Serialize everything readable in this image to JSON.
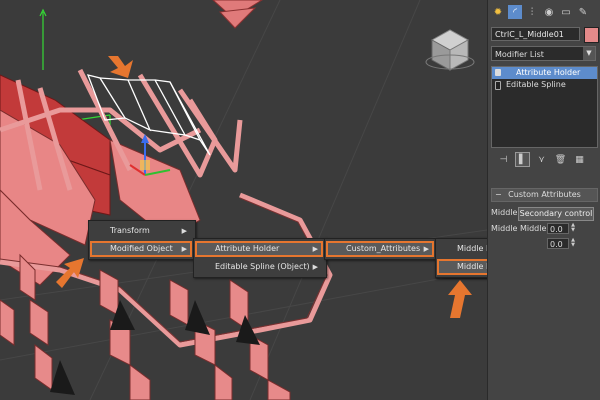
{
  "command_panel": {
    "object_name": "CtrlC_L_Middle01",
    "modifier_list_label": "Modifier List",
    "stack": [
      {
        "label": "Attribute Holder",
        "selected": true
      },
      {
        "label": "Editable Spline",
        "selected": false
      }
    ],
    "rollout_title": "Custom Attributes",
    "middle_label": "Middle:",
    "middle_button": "Secondary control",
    "middle_middle_y_label": "Middle Middle Y:",
    "middle_middle_y_value": "0.0",
    "middle_end_y_value": "0.0",
    "tab_icons": [
      "sun-icon",
      "arc-icon",
      "hierarchy-icon",
      "motion-icon",
      "display-icon",
      "utilities-icon"
    ],
    "stack_tool_icons": [
      "pin-icon",
      "show-end-result-icon",
      "make-unique-icon",
      "remove-modifier-icon",
      "configure-icon"
    ]
  },
  "context_menu": {
    "level1": [
      {
        "label": "Transform",
        "highlighted": false
      },
      {
        "label": "Modified Object",
        "highlighted": true
      }
    ],
    "level2": [
      {
        "label": "Attribute Holder",
        "highlighted": true
      },
      {
        "label": "Editable Spline (Object)",
        "highlighted": false
      }
    ],
    "level3": [
      {
        "label": "Custom_Attributes",
        "highlighted": true
      }
    ],
    "level4": [
      {
        "label": "Middle Middle Y",
        "highlighted": false
      },
      {
        "label": "Middle End Y",
        "highlighted": true
      }
    ]
  },
  "colors": {
    "accent_orange": "#e6762f",
    "selection_blue": "#5d8ccc",
    "object_pink": "#e48a8a",
    "viewport_bg": "#3b3b3b"
  }
}
